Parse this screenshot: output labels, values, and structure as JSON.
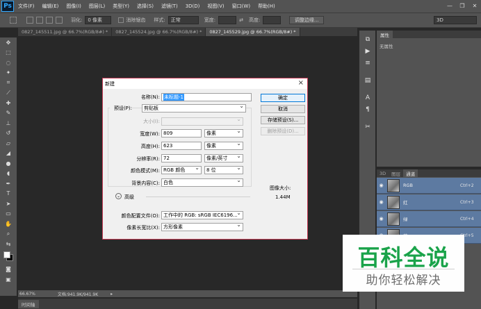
{
  "app": {
    "logo": "Ps"
  },
  "menu": [
    "文件(F)",
    "编辑(E)",
    "图像(I)",
    "图层(L)",
    "类型(Y)",
    "选择(S)",
    "滤镜(T)",
    "3D(D)",
    "视图(V)",
    "窗口(W)",
    "帮助(H)"
  ],
  "window_controls": [
    "—",
    "❐",
    "✕"
  ],
  "options": {
    "feather_label": "羽化:",
    "feather_value": "0 像素",
    "antialias_label": "消除锯齿",
    "style_label": "样式:",
    "style_value": "正常",
    "width_label": "宽度:",
    "height_label": "高度:",
    "refine_button": "调整边缘...",
    "workspace_value": "3D"
  },
  "tabs": [
    {
      "label": "0827_145511.jpg @ 66.7%(RGB/8#) *",
      "active": false
    },
    {
      "label": "0827_145524.jpg @ 66.7%(RGB/8#) *",
      "active": false
    },
    {
      "label": "0827_145529.jpg @ 66.7%(RGB/8#) *",
      "active": true
    }
  ],
  "status": {
    "zoom": "66.67%",
    "doc_size": "文档:941.9K/941.9K"
  },
  "timeline_label": "时间轴",
  "properties": {
    "tab": "属性",
    "content": "无属性"
  },
  "channels": {
    "tabs": [
      {
        "label": "3D",
        "active": false
      },
      {
        "label": "图层",
        "active": false
      },
      {
        "label": "通道",
        "active": true
      }
    ],
    "rows": [
      {
        "name": "RGB",
        "key": "Ctrl+2"
      },
      {
        "name": "红",
        "key": "Ctrl+3"
      },
      {
        "name": "绿",
        "key": "Ctrl+4"
      },
      {
        "name": "蓝",
        "key": "Ctrl+5"
      }
    ]
  },
  "dialog": {
    "title": "新建",
    "name_label": "名称(N):",
    "name_value": "未标题-1",
    "preset_label": "预设(P):",
    "preset_value": "剪贴板",
    "size_label": "大小(I):",
    "width_label": "宽度(W):",
    "width_value": "809",
    "width_unit": "像素",
    "height_label": "高度(H):",
    "height_value": "623",
    "height_unit": "像素",
    "resolution_label": "分辨率(R):",
    "resolution_value": "72",
    "resolution_unit": "像素/英寸",
    "colormode_label": "颜色模式(M):",
    "colormode_value": "RGB 颜色",
    "bitdepth_value": "8 位",
    "background_label": "背景内容(C):",
    "background_value": "白色",
    "advanced_label": "高级",
    "profile_label": "颜色配置文件(O):",
    "profile_value": "工作中的 RGB: sRGB IEC6196...",
    "aspect_label": "像素长宽比(X):",
    "aspect_value": "方形像素",
    "ok_button": "确定",
    "cancel_button": "取消",
    "save_preset_button": "存储预设(S)...",
    "delete_preset_button": "删除预设(D)...",
    "image_size_label": "图像大小:",
    "image_size_value": "1.44M"
  },
  "watermark": {
    "main": "百科全说",
    "sub": "助你轻松解决"
  }
}
